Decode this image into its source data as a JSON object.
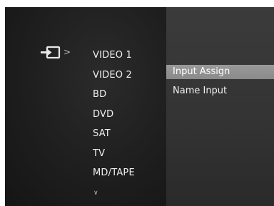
{
  "menu": {
    "breadcrumb_arrow": ">",
    "sources": [
      "VIDEO 1",
      "VIDEO 2",
      "BD",
      "DVD",
      "SAT",
      "TV",
      "MD/TAPE"
    ],
    "scroll_indicator": "∨"
  },
  "submenu": {
    "items": [
      {
        "label": "Input Assign",
        "selected": true
      },
      {
        "label": "Name Input",
        "selected": false
      }
    ]
  },
  "icons": {
    "input_icon": "input-icon"
  },
  "colors": {
    "screen_background": "#1a1a1a",
    "right_panel": "#363636",
    "highlight": "#929292",
    "text": "#f0f0f0"
  }
}
